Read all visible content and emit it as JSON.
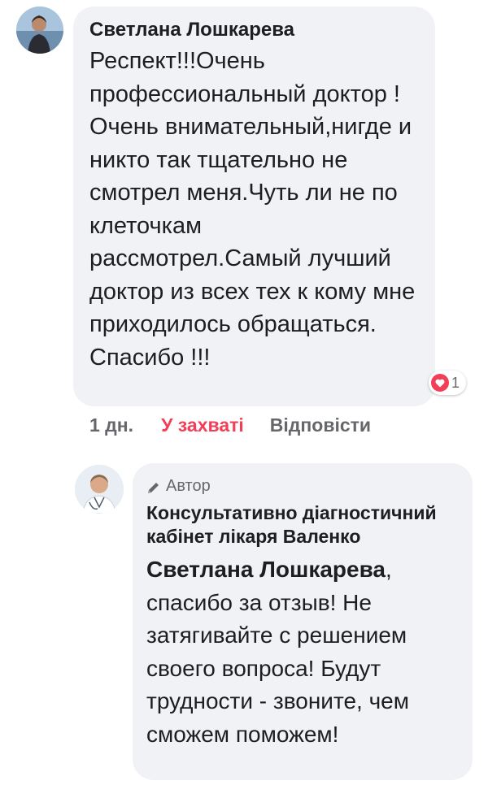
{
  "comment": {
    "author": "Светлана Лошкарева",
    "text": "Респект!!!Очень профессиональный доктор !Очень внимательный,нигде и никто так тщательно не смотрел меня.Чуть ли не по клеточкам рассмотрел.Самый лучший доктор из всех тех к кому мне приходилось обращаться. Спасибо !!!",
    "reaction": {
      "icon": "heart-icon",
      "count": "1",
      "color": "#f33e58"
    },
    "actions": {
      "time": "1 дн.",
      "react": "У захваті",
      "reply": "Відповісти"
    }
  },
  "reply": {
    "badge": {
      "icon": "pencil-icon",
      "label": "Автор"
    },
    "author": "Консультативно діагностичний кабінет лікаря Валенко",
    "mention": "Светлана Лошкарева",
    "text": ", спасибо за отзыв! Не затягивайте с решением своего вопроса! Будут трудности - звоните, чем сможем поможем!"
  },
  "colors": {
    "bubble": "#f0f2f5",
    "text": "#1c1e21",
    "muted": "#65676b",
    "accent": "#f33e58"
  }
}
